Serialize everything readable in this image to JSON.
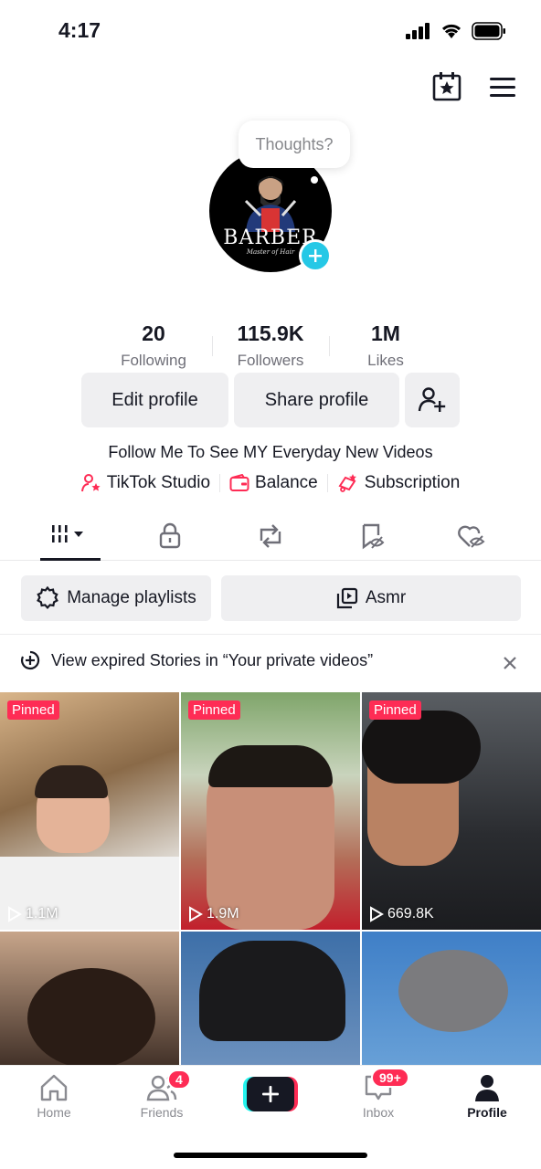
{
  "status": {
    "time": "4:17"
  },
  "profile": {
    "thought_bubble": "Thoughts?",
    "avatar_text": "BARBER",
    "avatar_subtext": "Master of Hair"
  },
  "stats": [
    {
      "value": "20",
      "label": "Following"
    },
    {
      "value": "115.9K",
      "label": "Followers"
    },
    {
      "value": "1M",
      "label": "Likes"
    }
  ],
  "actions": {
    "edit": "Edit profile",
    "share": "Share profile"
  },
  "bio": "Follow Me To See MY Everyday New Videos",
  "links": [
    {
      "label": "TikTok Studio",
      "icon": "person-star-icon"
    },
    {
      "label": "Balance",
      "icon": "wallet-icon"
    },
    {
      "label": "Subscription",
      "icon": "subscription-icon"
    }
  ],
  "playlists": {
    "manage": "Manage playlists",
    "playlist": "Asmr"
  },
  "notice": {
    "text": "View expired Stories in “Your private videos”"
  },
  "videos": [
    {
      "pinned": "Pinned",
      "views": "1.1M"
    },
    {
      "pinned": "Pinned",
      "views": "1.9M"
    },
    {
      "pinned": "Pinned",
      "views": "669.8K"
    },
    {
      "pinned": "",
      "views": ""
    },
    {
      "pinned": "",
      "views": ""
    },
    {
      "pinned": "",
      "views": ""
    }
  ],
  "nav": {
    "home": "Home",
    "friends": "Friends",
    "friends_badge": "4",
    "inbox": "Inbox",
    "inbox_badge": "99+",
    "profile": "Profile"
  },
  "colors": {
    "accent": "#fe2c55",
    "cyan": "#25c8e6"
  }
}
